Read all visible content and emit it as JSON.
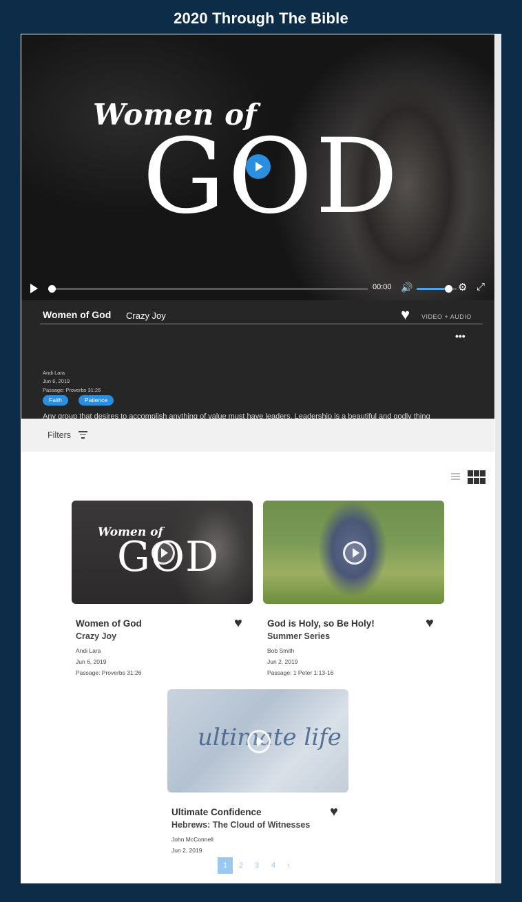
{
  "page": {
    "title": "2020 Through The Bible"
  },
  "player": {
    "hero_line1": "Women of",
    "hero_line2": "GOD",
    "time": "00:00",
    "volume": 0.8,
    "progress": 0
  },
  "featured": {
    "title": "Women of God",
    "series": "Crazy Joy",
    "media_label": "VIDEO + AUDIO",
    "speaker": "Andi Lara",
    "date": "Jun 6, 2019",
    "passage": "Passage: Proverbs 31:26",
    "tags": [
      "Faith",
      "Patience"
    ],
    "description": "Any group that desires to accomplish anything of value must have leaders. Leadership is a beautiful and godly thing if done right. The churches in Cre..."
  },
  "filters": {
    "label": "Filters"
  },
  "cards": [
    {
      "thumb_text1": "Women of",
      "thumb_text2": "GOD",
      "title": "Women of God",
      "series": "Crazy Joy",
      "speaker": "Andi Lara",
      "date": "Jun 6, 2019",
      "passage": "Passage: Proverbs 31:26"
    },
    {
      "title": "God is Holy, so Be Holy!",
      "series": "Summer Series",
      "speaker": "Bob Smith",
      "date": "Jun 2, 2019",
      "passage": "Passage: 1 Peter 1:13-16"
    },
    {
      "thumb_text1": "ultimate life",
      "title": "Ultimate Confidence",
      "series": "Hebrews: The Cloud of Witnesses",
      "speaker": "John McConnell",
      "date": "Jun 2, 2019"
    }
  ],
  "pagination": {
    "pages": [
      "1",
      "2",
      "3",
      "4",
      "›"
    ],
    "current": "1"
  },
  "colors": {
    "background": "#0c2c47",
    "accent": "#2b8fe0",
    "pager": "#9bc8ef"
  },
  "icons": [
    "play-icon",
    "volume-icon",
    "gear-icon",
    "fullscreen-icon",
    "heart-icon",
    "more-icon",
    "chevron-down-icon",
    "filter-icon",
    "list-view-icon",
    "grid-view-icon"
  ]
}
